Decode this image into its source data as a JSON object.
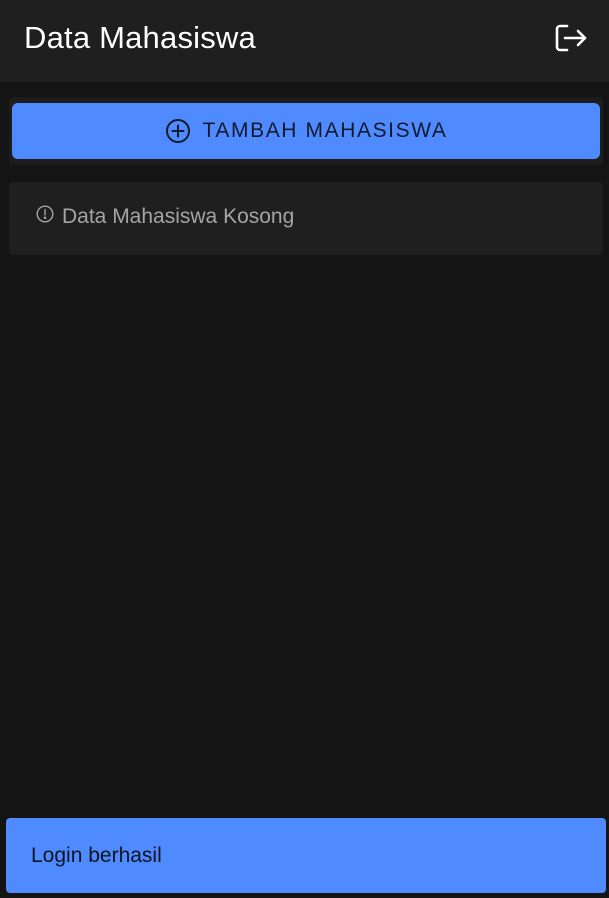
{
  "header": {
    "title": "Data Mahasiswa",
    "logout_icon": "logout-icon"
  },
  "actions": {
    "add_label": "TAMBAH MAHASISWA",
    "add_icon": "plus-circle-icon"
  },
  "empty_state": {
    "message": "Data Mahasiswa Kosong",
    "icon": "info-circle-icon"
  },
  "snackbar": {
    "message": "Login berhasil"
  },
  "colors": {
    "background": "#141414",
    "header": "#1f1f1f",
    "accent": "#4f8bff",
    "card": "#1f1f1f",
    "muted_text": "#a4a4a4"
  }
}
